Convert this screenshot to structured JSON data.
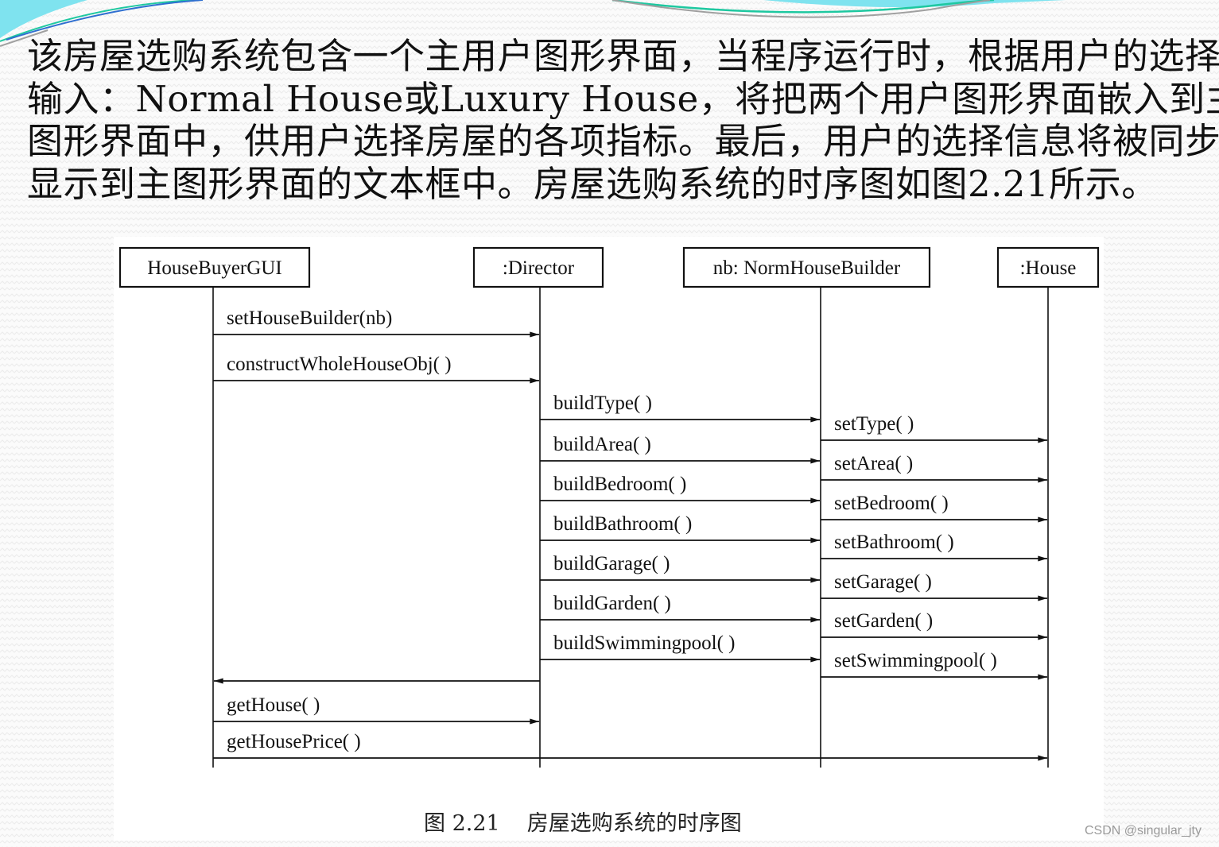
{
  "slide": {
    "paragraph_lines": [
      "该房屋选购系统包含一个主用户图形界面，当程序运行时，根据用户的选择",
      "输入：Normal House或Luxury House，将把两个用户图形界面嵌入到主用户",
      "图形界面中，供用户选择房屋的各项指标。最后，用户的选择信息将被同步",
      "显示到主图形界面的文本框中。房屋选购系统的时序图如图2.21所示。"
    ],
    "decoration_colors": {
      "cyan": "#7fe3ef",
      "teal": "#1ec8a0",
      "blue": "#2f6fd0",
      "gray": "#a0a0a0"
    }
  },
  "diagram": {
    "type": "sequence",
    "lifelines": [
      {
        "id": "gui",
        "label": "HouseBuyerGUI"
      },
      {
        "id": "director",
        "label": ":Director"
      },
      {
        "id": "builder",
        "label": "nb: NormHouseBuilder"
      },
      {
        "id": "house",
        "label": ":House"
      }
    ],
    "messages": [
      {
        "from": "gui",
        "to": "director",
        "label": "setHouseBuilder(nb)"
      },
      {
        "from": "gui",
        "to": "director",
        "label": "constructWholeHouseObj( )"
      },
      {
        "from": "director",
        "to": "builder",
        "label": "buildType( )"
      },
      {
        "from": "builder",
        "to": "house",
        "label": "setType( )"
      },
      {
        "from": "director",
        "to": "builder",
        "label": "buildArea( )"
      },
      {
        "from": "builder",
        "to": "house",
        "label": "setArea( )"
      },
      {
        "from": "director",
        "to": "builder",
        "label": "buildBedroom( )"
      },
      {
        "from": "builder",
        "to": "house",
        "label": "setBedroom( )"
      },
      {
        "from": "director",
        "to": "builder",
        "label": "buildBathroom( )"
      },
      {
        "from": "builder",
        "to": "house",
        "label": "setBathroom( )"
      },
      {
        "from": "director",
        "to": "builder",
        "label": "buildGarage( )"
      },
      {
        "from": "builder",
        "to": "house",
        "label": "setGarage( )"
      },
      {
        "from": "director",
        "to": "builder",
        "label": "buildGarden( )"
      },
      {
        "from": "builder",
        "to": "house",
        "label": "setGarden( )"
      },
      {
        "from": "director",
        "to": "builder",
        "label": "buildSwimmingpool( )"
      },
      {
        "from": "builder",
        "to": "house",
        "label": "setSwimmingpool( )"
      },
      {
        "from": "director",
        "to": "gui",
        "label": ""
      },
      {
        "from": "gui",
        "to": "director",
        "label": "getHouse( )"
      },
      {
        "from": "gui",
        "to": "house",
        "label": "getHousePrice( )"
      }
    ],
    "caption_number": "图 2.21",
    "caption_text": "房屋选购系统的时序图"
  },
  "watermark": "CSDN @singular_jty"
}
